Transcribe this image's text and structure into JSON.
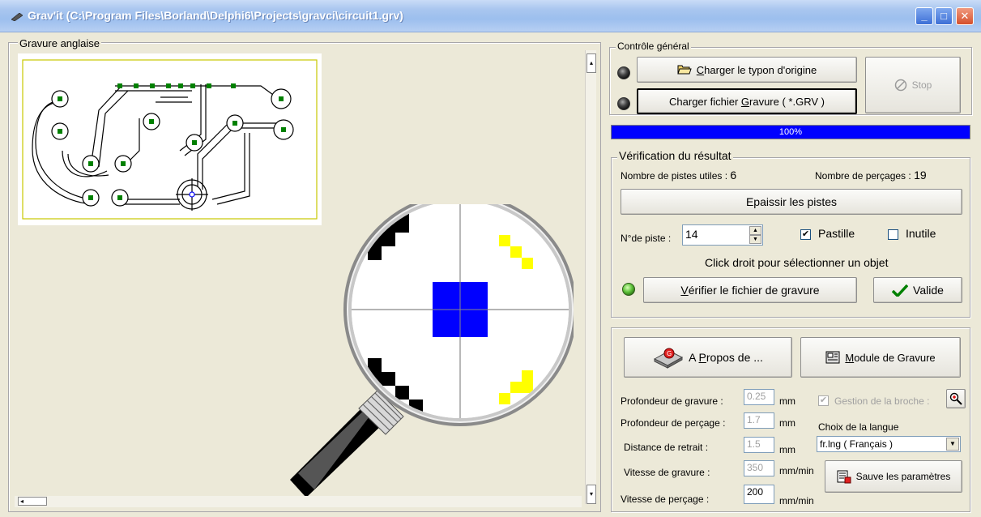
{
  "window": {
    "title": "Grav'it (C:\\Program Files\\Borland\\Delphi6\\Projects\\gravci\\circuit1.grv)",
    "min_glyph": "_",
    "max_glyph": "□",
    "close_glyph": "✕"
  },
  "left": {
    "legend": "Gravure anglaise",
    "vscroll_up": "▴",
    "vscroll_down": "▾",
    "hscroll_left": "◂"
  },
  "general": {
    "legend": "Contrôle général",
    "load_origin_label": "Charger le typon d'origine",
    "load_origin_accel": "C",
    "load_origin_rest": "harger le typon d'origine",
    "load_grv_pre": "Charger fichier ",
    "load_grv_accel": "G",
    "load_grv_post": "ravure ( *.GRV )",
    "stop_label": "Stop",
    "progress_text": "100%",
    "progress_value": 1.0
  },
  "verification": {
    "legend": "Vérification du résultat",
    "tracks_label": "Nombre de pistes utiles : ",
    "tracks_value": "6",
    "drills_label": "Nombre de perçages : ",
    "drills_value": "19",
    "thicken_label": "Epaissir les pistes",
    "track_no_label": "N°de piste :",
    "track_no_value": "14",
    "pastille_label": "Pastille",
    "pastille_checked": true,
    "inutile_label": "Inutile",
    "inutile_checked": false,
    "hint": "Click droit pour sélectionner un objet",
    "verify_accel": "V",
    "verify_rest": "érifier le fichier de gravure",
    "valid_label": "Valide"
  },
  "settings": {
    "about_pre": "A ",
    "about_accel": "P",
    "about_post": "ropos de ...",
    "module_accel": "M",
    "module_rest": "odule de Gravure",
    "depth_label": "Profondeur de gravure :",
    "depth_value": "0.25",
    "depth_unit": "mm",
    "drill_depth_label": "Profondeur de perçage :",
    "drill_depth_value": "1.7",
    "drill_depth_unit": "mm",
    "retract_label": "Distance de retrait :",
    "retract_value": "1.5",
    "retract_unit": "mm",
    "speed_label": "Vitesse de gravure :",
    "speed_value": "350",
    "speed_unit": "mm/min",
    "drill_speed_label": "Vitesse de perçage :",
    "drill_speed_value": "200",
    "drill_speed_unit": "mm/min",
    "spindle_label": "Gestion de la broche :",
    "spindle_checked": true,
    "language_label": "Choix de la langue",
    "language_value": "fr.lng ( Français )",
    "save_label": "Sauve les paramètres"
  },
  "colors": {
    "progress": "#0000ff",
    "titlebar": "#9cbfee",
    "pad": "#008000",
    "magnifier_blue": "#0000ff",
    "magnifier_yellow": "#ffff00"
  },
  "icons": {
    "title": "pen-icon",
    "load_origin": "folder-open-icon",
    "stop": "stop-icon",
    "valid": "checkmark-icon",
    "about": "chip-icon",
    "module": "module-icon",
    "save": "save-params-icon",
    "zoom": "zoom-icon"
  }
}
